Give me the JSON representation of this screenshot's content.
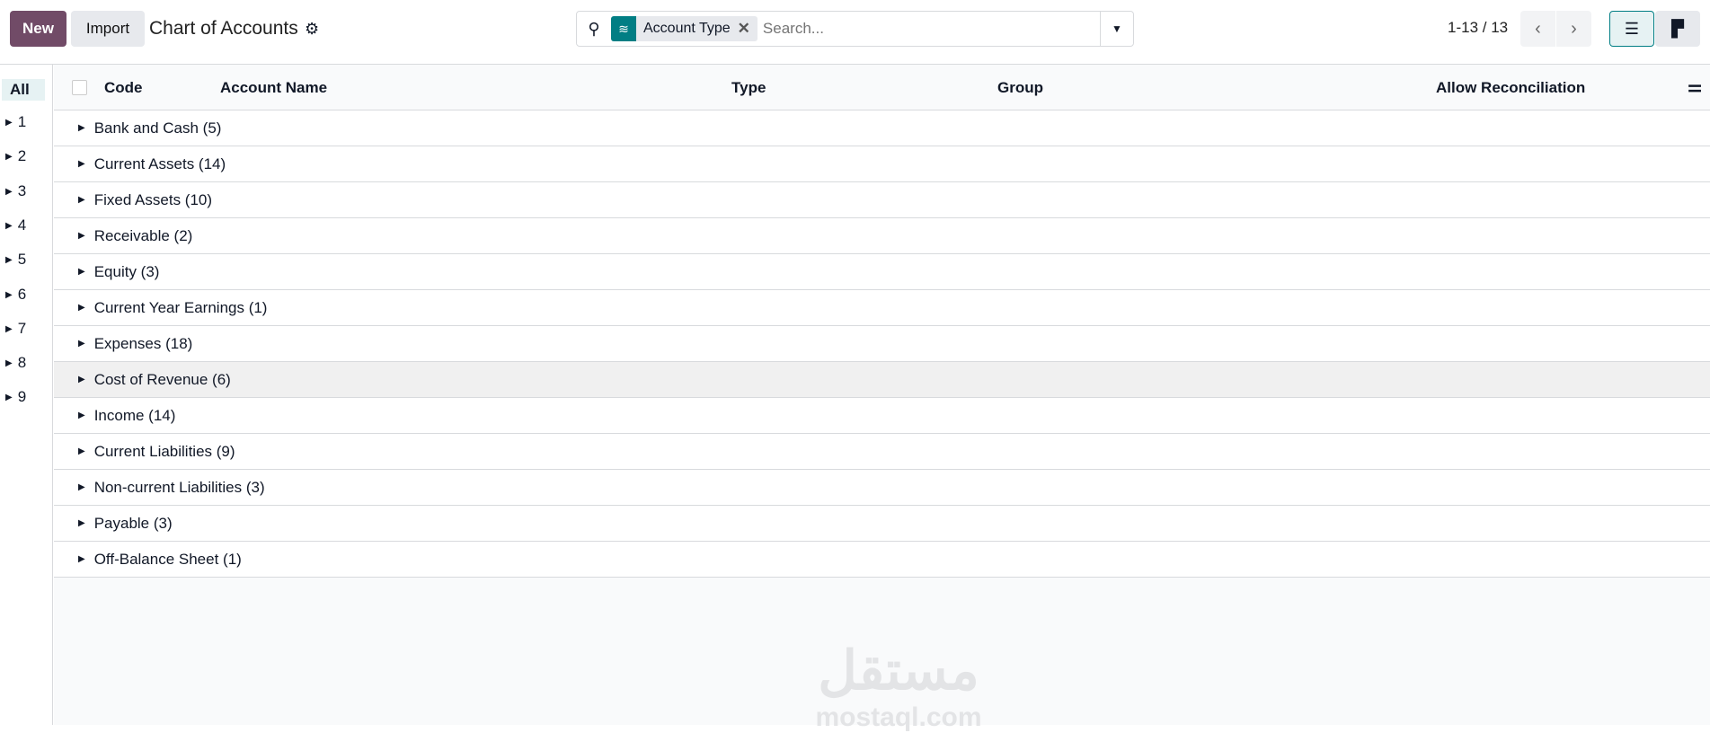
{
  "toolbar": {
    "new_label": "New",
    "import_label": "Import",
    "title": "Chart of Accounts"
  },
  "search": {
    "facet_label": "Account Type",
    "placeholder": "Search..."
  },
  "pager": {
    "text": "1-13 / 13"
  },
  "sidebar": {
    "items": [
      "All",
      "1",
      "2",
      "3",
      "4",
      "5",
      "6",
      "7",
      "8",
      "9"
    ]
  },
  "table": {
    "columns": [
      "Code",
      "Account Name",
      "Type",
      "Group",
      "Allow Reconciliation"
    ],
    "groups": [
      "Bank and Cash (5)",
      "Current Assets (14)",
      "Fixed Assets (10)",
      "Receivable (2)",
      "Equity (3)",
      "Current Year Earnings (1)",
      "Expenses (18)",
      "Cost of Revenue (6)",
      "Income (14)",
      "Current Liabilities (9)",
      "Non-current Liabilities (3)",
      "Payable (3)",
      "Off-Balance Sheet (1)"
    ]
  },
  "watermark": {
    "arabic": "مستقل",
    "latin": "mostaql.com"
  },
  "colors": {
    "primary": "#714b67",
    "accent": "#017e84"
  }
}
